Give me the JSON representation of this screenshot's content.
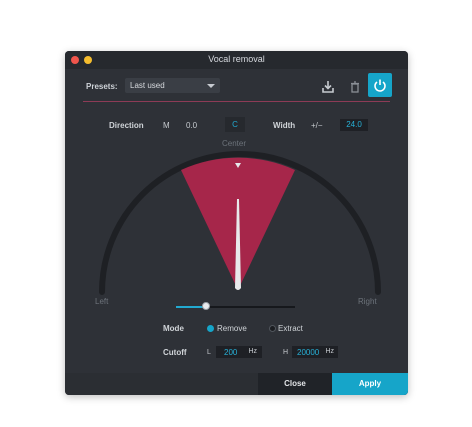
{
  "window": {
    "title": "Vocal removal"
  },
  "presets": {
    "label": "Presets:",
    "selected": "Last used"
  },
  "toolbar": {
    "download_icon": "download-icon",
    "trash_icon": "trash-icon",
    "power_icon": "power-icon"
  },
  "direction": {
    "label": "Direction",
    "channel": "M",
    "value": "0.0",
    "center_button": "C",
    "center_caption": "Center"
  },
  "width": {
    "label": "Width",
    "plus_minus": "+/−",
    "value": "24.0"
  },
  "dial": {
    "left_label": "Left",
    "right_label": "Right"
  },
  "slider": {
    "fraction": 0.27
  },
  "mode": {
    "label": "Mode",
    "options": [
      "Remove",
      "Extract"
    ],
    "selected": "Remove"
  },
  "cutoff": {
    "label": "Cutoff",
    "low_prefix": "L",
    "low_value": "200",
    "low_unit": "Hz",
    "high_prefix": "H",
    "high_value": "20000",
    "high_unit": "Hz"
  },
  "buttons": {
    "close": "Close",
    "apply": "Apply"
  },
  "colors": {
    "accent": "#16a5c9",
    "sector": "#a6264a",
    "window_bg": "#2e3137"
  }
}
